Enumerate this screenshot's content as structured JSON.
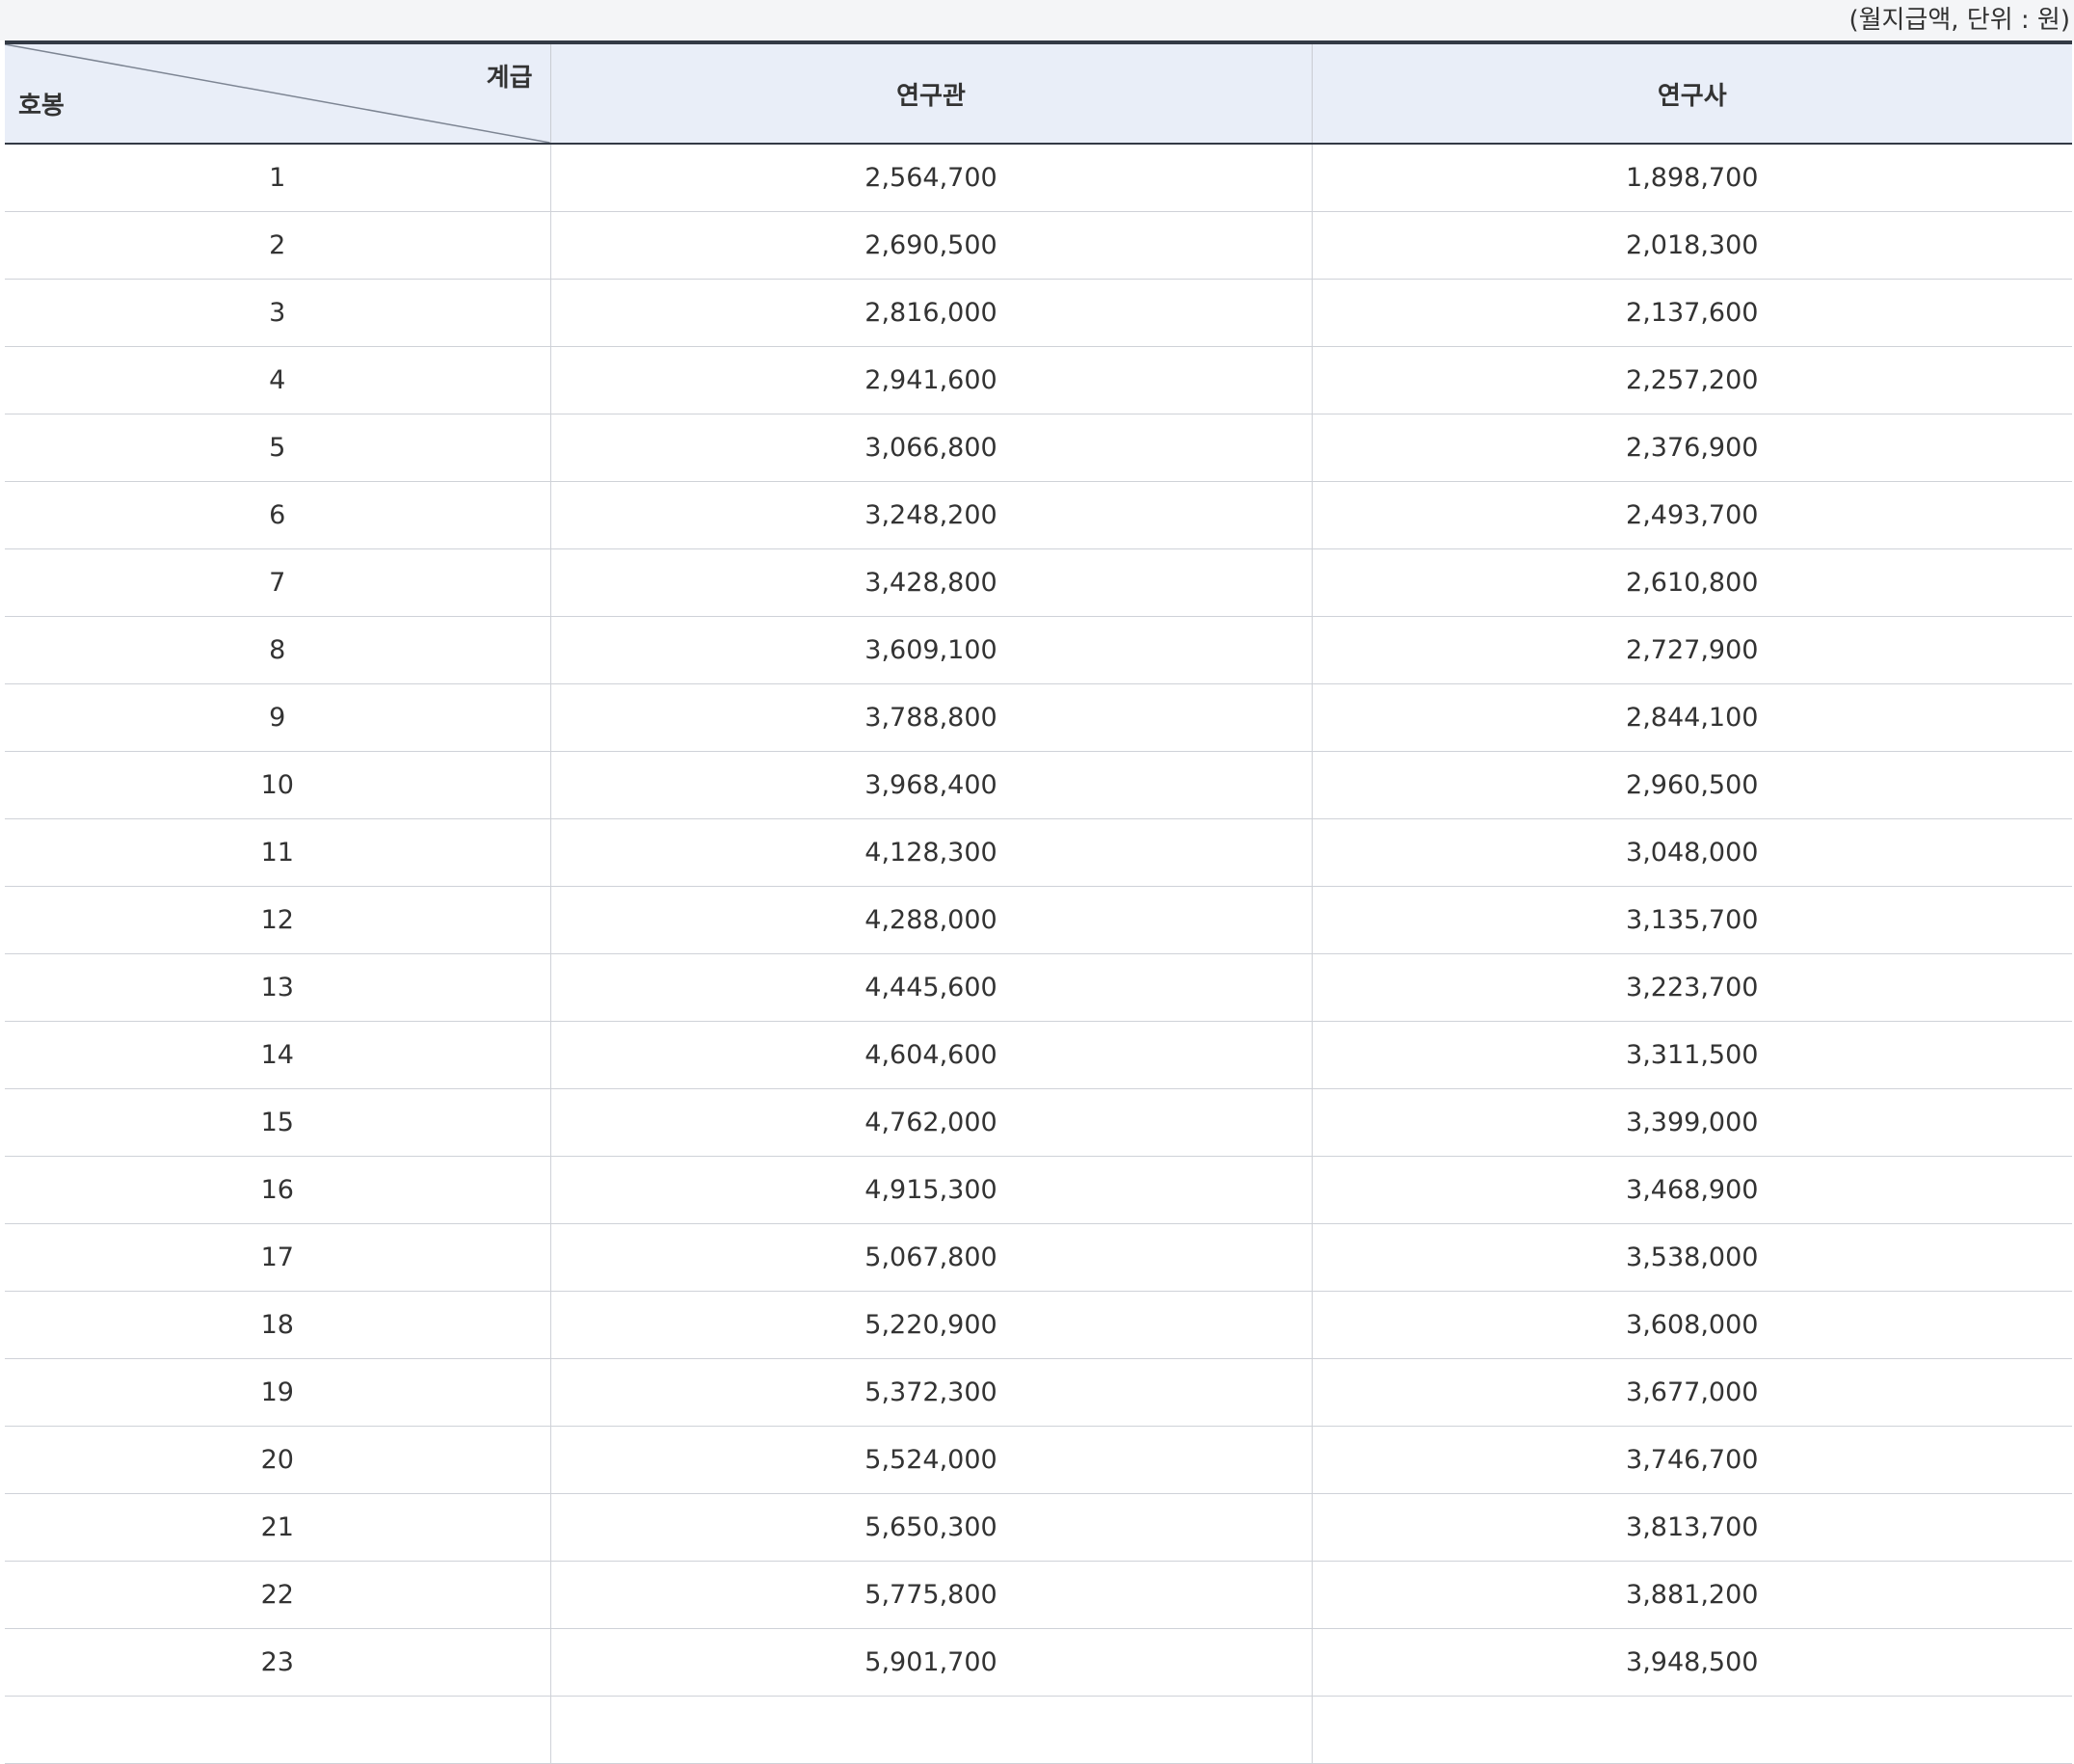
{
  "unit_note": "(월지급액, 단위 : 원)",
  "header": {
    "grade_label": "계급",
    "step_label": "호봉",
    "col_researcher_senior": "연구관",
    "col_researcher": "연구사"
  },
  "rows": [
    {
      "step": "1",
      "senior": "2,564,700",
      "researcher": "1,898,700"
    },
    {
      "step": "2",
      "senior": "2,690,500",
      "researcher": "2,018,300"
    },
    {
      "step": "3",
      "senior": "2,816,000",
      "researcher": "2,137,600"
    },
    {
      "step": "4",
      "senior": "2,941,600",
      "researcher": "2,257,200"
    },
    {
      "step": "5",
      "senior": "3,066,800",
      "researcher": "2,376,900"
    },
    {
      "step": "6",
      "senior": "3,248,200",
      "researcher": "2,493,700"
    },
    {
      "step": "7",
      "senior": "3,428,800",
      "researcher": "2,610,800"
    },
    {
      "step": "8",
      "senior": "3,609,100",
      "researcher": "2,727,900"
    },
    {
      "step": "9",
      "senior": "3,788,800",
      "researcher": "2,844,100"
    },
    {
      "step": "10",
      "senior": "3,968,400",
      "researcher": "2,960,500"
    },
    {
      "step": "11",
      "senior": "4,128,300",
      "researcher": "3,048,000"
    },
    {
      "step": "12",
      "senior": "4,288,000",
      "researcher": "3,135,700"
    },
    {
      "step": "13",
      "senior": "4,445,600",
      "researcher": "3,223,700"
    },
    {
      "step": "14",
      "senior": "4,604,600",
      "researcher": "3,311,500"
    },
    {
      "step": "15",
      "senior": "4,762,000",
      "researcher": "3,399,000"
    },
    {
      "step": "16",
      "senior": "4,915,300",
      "researcher": "3,468,900"
    },
    {
      "step": "17",
      "senior": "5,067,800",
      "researcher": "3,538,000"
    },
    {
      "step": "18",
      "senior": "5,220,900",
      "researcher": "3,608,000"
    },
    {
      "step": "19",
      "senior": "5,372,300",
      "researcher": "3,677,000"
    },
    {
      "step": "20",
      "senior": "5,524,000",
      "researcher": "3,746,700"
    },
    {
      "step": "21",
      "senior": "5,650,300",
      "researcher": "3,813,700"
    },
    {
      "step": "22",
      "senior": "5,775,800",
      "researcher": "3,881,200"
    },
    {
      "step": "23",
      "senior": "5,901,700",
      "researcher": "3,948,500"
    },
    {
      "step": "",
      "senior": "",
      "researcher": ""
    }
  ]
}
